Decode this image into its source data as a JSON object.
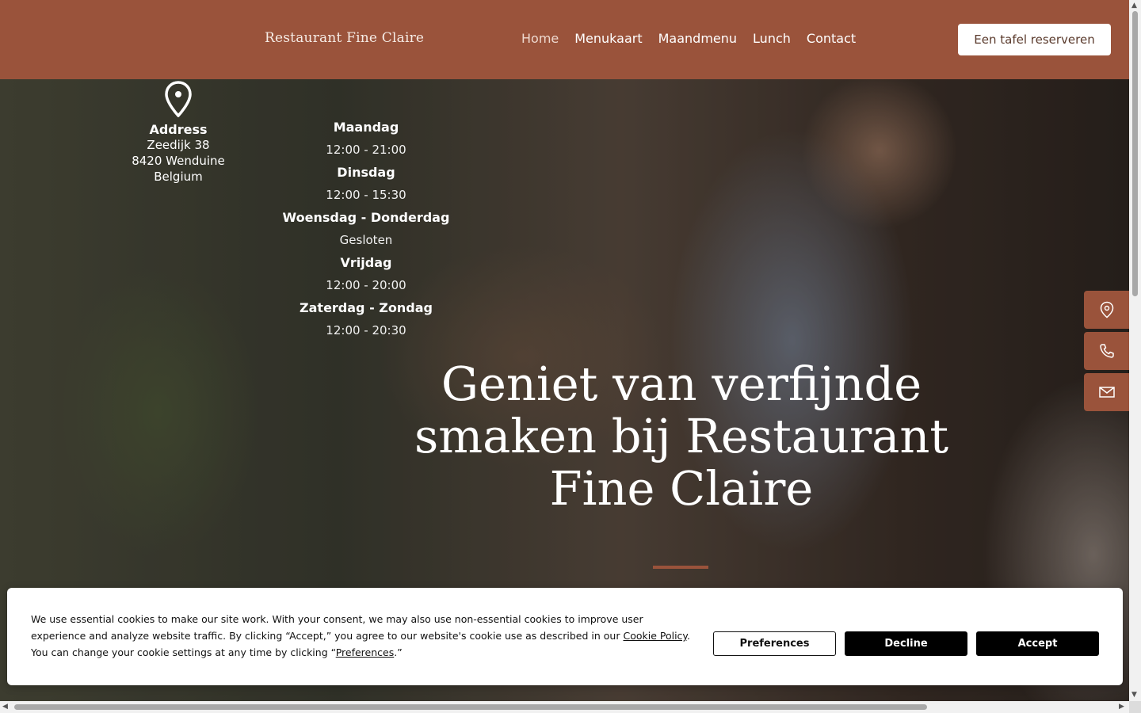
{
  "header": {
    "brand": "Restaurant Fine Claire",
    "nav": [
      "Home",
      "Menukaart",
      "Maandmenu",
      "Lunch",
      "Contact"
    ],
    "active_nav": "Home",
    "reserve_label": "Een tafel reserveren"
  },
  "info": {
    "address_title": "Address",
    "address_lines": [
      "Zeedijk 38",
      "8420 Wenduine",
      "Belgium"
    ],
    "hours": [
      {
        "day": "Maandag",
        "time": "12:00 - 21:00"
      },
      {
        "day": "Dinsdag",
        "time": "12:00 - 15:30"
      },
      {
        "day": "Woensdag - Donderdag",
        "time": "Gesloten"
      },
      {
        "day": "Vrijdag",
        "time": "12:00 - 20:00"
      },
      {
        "day": "Zaterdag - Zondag",
        "time": "12:00 - 20:30"
      }
    ]
  },
  "hero": {
    "title": "Geniet van verfijnde smaken bij Restaurant Fine Claire"
  },
  "side_actions": [
    "map-pin-icon",
    "phone-icon",
    "mail-icon"
  ],
  "cookie": {
    "text_part1": "We use essential cookies to make our site work. With your consent, we may also use non-essential cookies to improve user experience and analyze website traffic. By clicking “Accept,” you agree to our website's cookie use as described in our ",
    "policy_link": "Cookie Policy",
    "text_part2": ". You can change your cookie settings at any time by clicking “",
    "preferences_link": "Preferences",
    "text_part3": ".”",
    "preferences_label": "Preferences",
    "decline_label": "Decline",
    "accept_label": "Accept"
  },
  "colors": {
    "brand": "#9a533b",
    "button_dark": "#000000",
    "white": "#ffffff"
  }
}
